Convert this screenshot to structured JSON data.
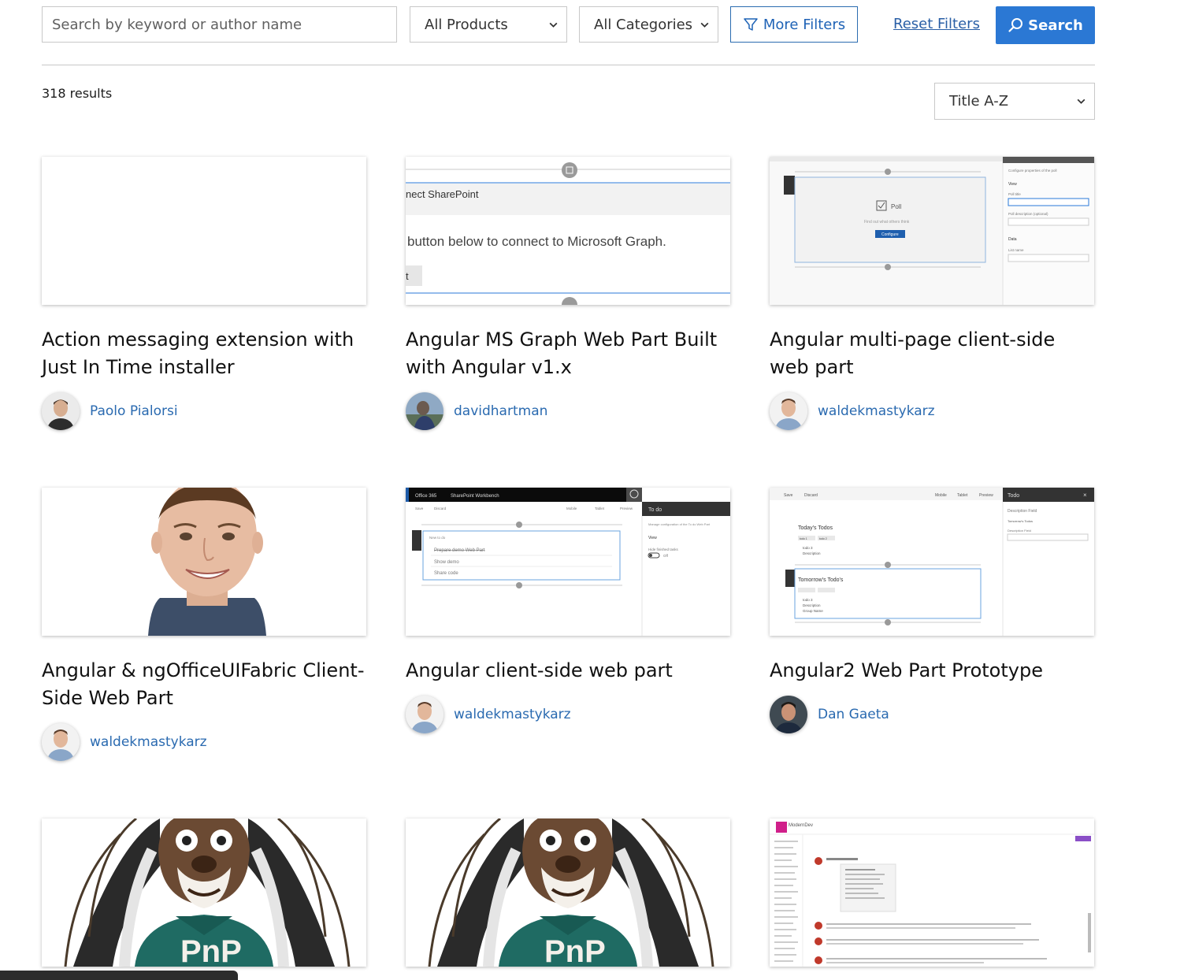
{
  "filters": {
    "search_placeholder": "Search by keyword or author name",
    "products": "All Products",
    "categories": "All Categories",
    "more_filters": "More Filters",
    "reset": "Reset Filters",
    "search": "Search"
  },
  "results": {
    "count": "318 results",
    "sort": "Title A-Z"
  },
  "cards": [
    {
      "title": "Action messaging extension with Just In Time installer",
      "author": "Paolo Pialorsi"
    },
    {
      "title": "Angular MS Graph Web Part Built with Angular v1.x",
      "author": "davidhartman",
      "thumb_text": [
        "nect SharePoint",
        "button below to connect to Microsoft Graph.",
        "t"
      ]
    },
    {
      "title": "Angular multi-page client-side web part",
      "author": "waldekmastykarz",
      "thumb_text": [
        "Poll",
        "Find out what others think",
        "Configure",
        "Configure properties of the poll",
        "View",
        "Poll title",
        "Poll description (optional)",
        "Data",
        "List name"
      ]
    },
    {
      "title": "Angular & ngOfficeUIFabric Client-Side Web Part",
      "author": "waldekmastykarz"
    },
    {
      "title": "Angular client-side web part",
      "author": "waldekmastykarz",
      "thumb_text": [
        "Office 365",
        "SharePoint Workbench",
        "Save",
        "Discard",
        "Mobile",
        "Tablet",
        "Preview",
        "To do",
        "New to do",
        "Prepare demo Web Part",
        "Show demo",
        "Share code",
        "Manage configuration of the To do Web Part",
        "View",
        "Hide finished tasks",
        "Off"
      ]
    },
    {
      "title": "Angular2 Web Part Prototype",
      "author": "Dan Gaeta",
      "thumb_text": [
        "Save",
        "Discard",
        "Mobile",
        "Tablet",
        "Preview",
        "Todo",
        "Today's Todos",
        "Tomorrow's Todo's",
        "Log Todos",
        "Add Todo",
        "todo 1",
        "todo 2",
        "todo 3",
        "Description",
        "Group Name",
        "Description Field",
        "Tomorrow's Todos"
      ]
    },
    {
      "title": "",
      "author": "",
      "thumb_text": [
        "PnP"
      ]
    },
    {
      "title": "",
      "author": "",
      "thumb_text": [
        "PnP"
      ]
    },
    {
      "title": "",
      "author": "",
      "thumb_text": [
        "ModernDev"
      ]
    }
  ],
  "colors": {
    "accent": "#2b78d4",
    "link": "#2a6ab0",
    "pnp_shirt": "#1f6b63"
  }
}
